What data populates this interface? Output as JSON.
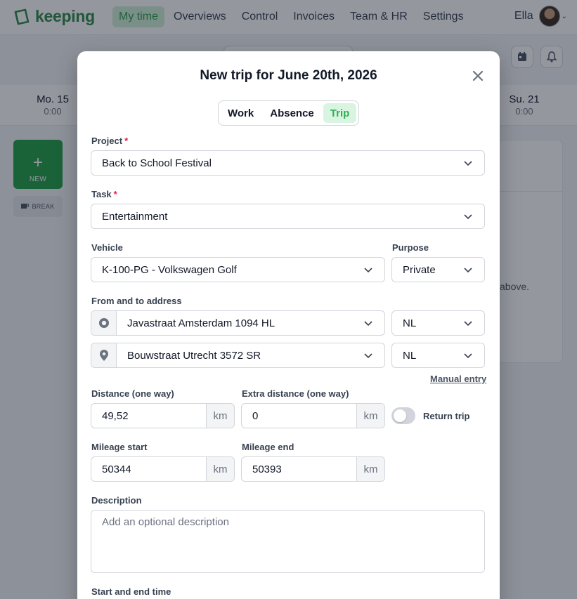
{
  "app": {
    "logo_text": "keeping",
    "nav": [
      "My time",
      "Overviews",
      "Control",
      "Invoices",
      "Team & HR",
      "Settings"
    ],
    "active_nav": "My time",
    "user_name": "Ella"
  },
  "week": {
    "first_day": {
      "name": "Mo. 15",
      "hours": "0:00"
    },
    "last_day": {
      "name": "Su. 21",
      "hours": "0:00"
    }
  },
  "sidebar": {
    "new_label": "NEW",
    "break_label": "BREAK"
  },
  "background_hint": "above.",
  "modal": {
    "title": "New trip for June 20th, 2026",
    "tabs": [
      {
        "label": "Work",
        "active": false
      },
      {
        "label": "Absence",
        "active": false
      },
      {
        "label": "Trip",
        "active": true
      }
    ],
    "project": {
      "label": "Project",
      "required_mark": "*",
      "value": "Back to School Festival"
    },
    "task": {
      "label": "Task",
      "required_mark": "*",
      "value": "Entertainment"
    },
    "vehicle": {
      "label": "Vehicle",
      "value": "K-100-PG - Volkswagen Golf"
    },
    "purpose": {
      "label": "Purpose",
      "value": "Private"
    },
    "addresses": {
      "label": "From and to address",
      "from": {
        "value": "Javastraat Amsterdam 1094 HL",
        "country": "NL"
      },
      "to": {
        "value": "Bouwstraat Utrecht 3572 SR",
        "country": "NL"
      }
    },
    "manual_entry_label": "Manual entry",
    "distance": {
      "label": "Distance (one way)",
      "value": "49,52",
      "unit": "km"
    },
    "extra_distance": {
      "label": "Extra distance (one way)",
      "value": "0",
      "unit": "km"
    },
    "return_trip": {
      "label": "Return trip",
      "enabled": false
    },
    "mileage_start": {
      "label": "Mileage start",
      "value": "50344",
      "unit": "km"
    },
    "mileage_end": {
      "label": "Mileage end",
      "value": "50393",
      "unit": "km"
    },
    "description": {
      "label": "Description",
      "placeholder": "Add an optional description"
    },
    "time_label": "Start and end time"
  },
  "colors": {
    "brand_green": "#22a045",
    "active_tab_text": "#2fae55",
    "active_tab_bg": "#d9f5e1",
    "required": "#e11d48"
  }
}
